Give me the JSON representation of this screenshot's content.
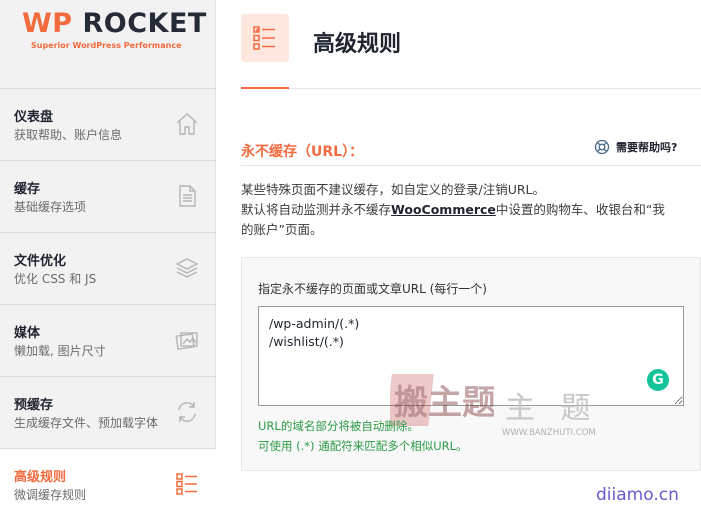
{
  "colors": {
    "accent": "#f16b3f",
    "dark": "#1e2430",
    "green": "#2b9a46",
    "grammarly": "#15c39a"
  },
  "logo": {
    "wordmark_a": "WP",
    "wordmark_b": " ROCKET",
    "tagline": "Superior WordPress Performance"
  },
  "sidebar": {
    "items": [
      {
        "title": "仪表盘",
        "subtitle": "获取帮助、账户信息",
        "icon": "home-icon"
      },
      {
        "title": "缓存",
        "subtitle": "基础缓存选项",
        "icon": "file-icon"
      },
      {
        "title": "文件优化",
        "subtitle": "优化 CSS 和 JS",
        "icon": "layers-icon"
      },
      {
        "title": "媒体",
        "subtitle": "懒加载, 图片尺寸",
        "icon": "images-icon"
      },
      {
        "title": "预缓存",
        "subtitle": "生成缓存文件、预加载字体",
        "icon": "refresh-icon"
      },
      {
        "title": "高级规则",
        "subtitle": "微调缓存规则",
        "icon": "checklist-icon",
        "active": true
      }
    ]
  },
  "page": {
    "title": "高级规则",
    "icon": "checklist-icon"
  },
  "section": {
    "title": "永不缓存（URL）：",
    "help_label": "需要帮助吗?",
    "desc_line1": "某些特殊页面不建议缓存，如自定义的登录/注销URL。",
    "desc_line2a": "默认将自动监测并永不缓存",
    "desc_brand": "WooCommerce",
    "desc_line2b": "中设置的购物车、收银台和“我",
    "desc_line3": "的账户”页面。",
    "field_label": "指定永不缓存的页面或文章URL (每行一个)",
    "textarea_value": "/wp-admin/(.*)\n/wishlist/(.*)",
    "grammarly_glyph": "G",
    "note1": "URL的域名部分将被自动删除。",
    "note2": "可使用 (.*) 通配符来匹配多个相似URL。"
  },
  "watermarks": {
    "stamp_text": "搬主题",
    "site_text": "主 题",
    "site_url": "WWW.BANZHUTI.COM",
    "footer": "diiamo.cn"
  }
}
